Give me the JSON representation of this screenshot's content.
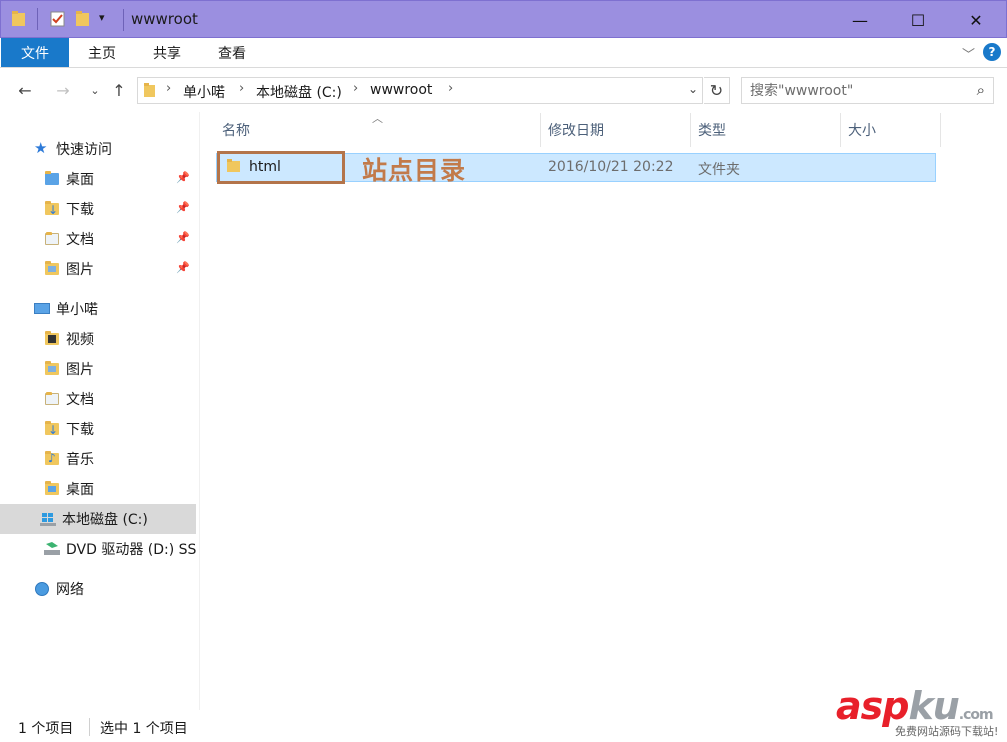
{
  "window": {
    "title": "wwwroot",
    "minimize_icon": "minimize-icon",
    "maximize_icon": "maximize-icon",
    "close_icon": "close-icon"
  },
  "ribbon": {
    "tabs": [
      {
        "label": "文件"
      },
      {
        "label": "主页"
      },
      {
        "label": "共享"
      },
      {
        "label": "查看"
      }
    ],
    "help_label": "?"
  },
  "address": {
    "crumbs": [
      "单小喏",
      "本地磁盘 (C:)",
      "wwwroot"
    ]
  },
  "search": {
    "placeholder": "搜索\"wwwroot\""
  },
  "sidebar": {
    "quick_access": {
      "label": "快速访问",
      "items": [
        {
          "label": "桌面"
        },
        {
          "label": "下载"
        },
        {
          "label": "文档"
        },
        {
          "label": "图片"
        }
      ]
    },
    "this_pc": {
      "label": "单小喏",
      "items": [
        {
          "label": "视频"
        },
        {
          "label": "图片"
        },
        {
          "label": "文档"
        },
        {
          "label": "下载"
        },
        {
          "label": "音乐"
        },
        {
          "label": "桌面"
        },
        {
          "label": "本地磁盘 (C:)"
        },
        {
          "label": "DVD 驱动器 (D:) SS"
        }
      ]
    },
    "network": {
      "label": "网络"
    }
  },
  "columns": {
    "name": "名称",
    "modified": "修改日期",
    "type": "类型",
    "size": "大小"
  },
  "files": [
    {
      "name": "html",
      "modified": "2016/10/21 20:22",
      "type": "文件夹",
      "size": ""
    }
  ],
  "annotation": {
    "text": "站点目录",
    "color": "#c27a4a"
  },
  "status": {
    "item_count": "1 个项目",
    "selected": "选中 1 个项目"
  },
  "watermark": {
    "brand_asp": "asp",
    "brand_ku": "ku",
    "domain": ".com",
    "subtitle": "免费网站源码下载站!"
  },
  "colors": {
    "title_bar": "#9b8fe0",
    "file_tab": "#1979ca",
    "selection": "#cce8ff"
  }
}
